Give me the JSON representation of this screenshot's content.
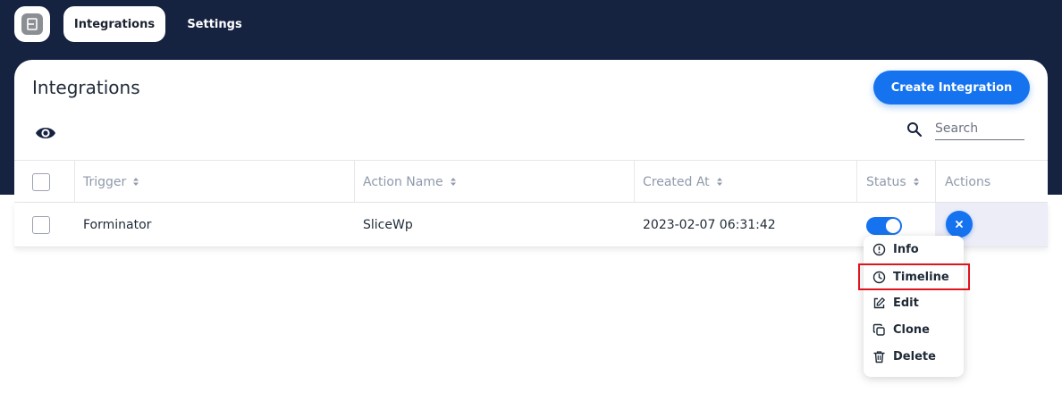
{
  "nav": {
    "logo": "app-logo",
    "tabs": [
      {
        "label": "Integrations",
        "active": true
      },
      {
        "label": "Settings",
        "active": false
      }
    ]
  },
  "page": {
    "title": "Integrations",
    "create_button": "Create Integration"
  },
  "toolbar": {
    "visibility_icon": "eye-icon",
    "search_icon": "search-icon",
    "search_placeholder": "Search",
    "search_value": ""
  },
  "table": {
    "columns": [
      "Trigger",
      "Action Name",
      "Created At",
      "Status",
      "Actions"
    ],
    "rows": [
      {
        "trigger": "Forminator",
        "action_name": "SliceWp",
        "created_at": "2023-02-07 06:31:42",
        "status_enabled": true,
        "selected": false
      }
    ]
  },
  "context_menu": {
    "items": [
      {
        "label": "Info",
        "icon": "info-icon"
      },
      {
        "label": "Timeline",
        "icon": "clock-icon",
        "highlighted": true
      },
      {
        "label": "Edit",
        "icon": "edit-icon"
      },
      {
        "label": "Clone",
        "icon": "copy-icon"
      },
      {
        "label": "Delete",
        "icon": "trash-icon"
      }
    ]
  },
  "colors": {
    "header_bg": "#152240",
    "primary": "#1673f0",
    "highlight_border": "#e0141e",
    "actions_cell_bg": "#ecedf7"
  }
}
